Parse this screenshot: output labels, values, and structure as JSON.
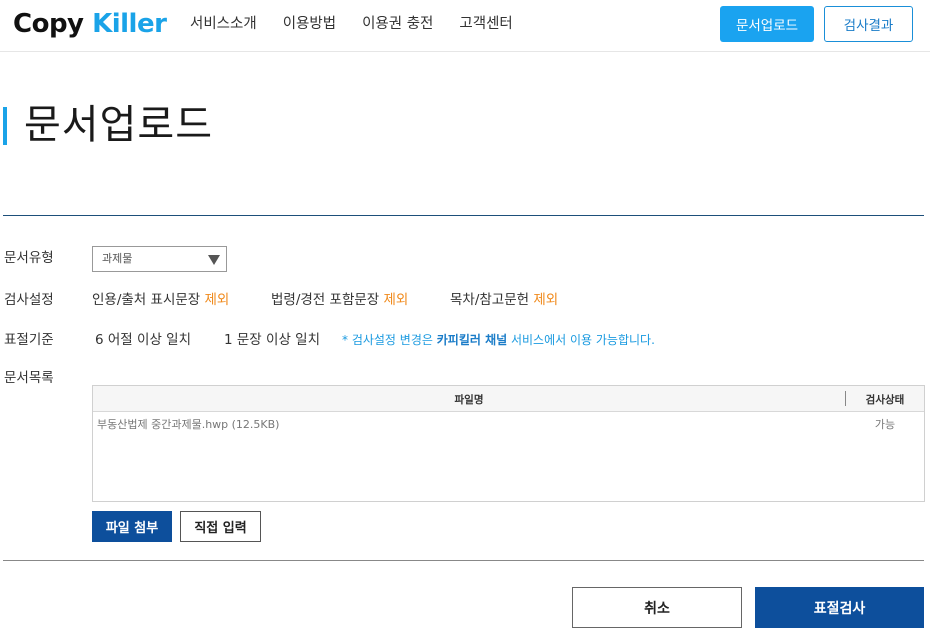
{
  "header": {
    "logo": {
      "part1": "Copy",
      "part2": "Killer"
    },
    "nav": [
      "서비스소개",
      "이용방법",
      "이용권 충전",
      "고객센터"
    ],
    "upload_button": "문서업로드",
    "result_button": "검사결과",
    "colors": {
      "accent": "#1aa3f0",
      "navy": "#0d4f9c",
      "orange": "#f08a1c"
    }
  },
  "page": {
    "title": "문서업로드"
  },
  "form": {
    "doc_type": {
      "label": "문서유형",
      "selected": "과제물"
    },
    "settings": {
      "label": "검사설정",
      "items": [
        {
          "name": "인용/출처 표시문장",
          "state": "제외"
        },
        {
          "name": "법령/경전 포함문장",
          "state": "제외"
        },
        {
          "name": "목차/참고문헌",
          "state": "제외"
        }
      ]
    },
    "criteria": {
      "label": "표절기준",
      "phrase_count": "6",
      "phrase_text": "어절 이상 일치",
      "sentence_count": "1",
      "sentence_text": "문장 이상 일치",
      "note_prefix": "* 검사설정 변경은 ",
      "note_bold": "카피킬러 채널",
      "note_suffix": " 서비스에서 이용 가능합니다."
    },
    "files": {
      "label": "문서목록",
      "columns": {
        "name": "파일명",
        "status": "검사상태"
      },
      "rows": [
        {
          "name": "부동산법제 중간과제물.hwp (12.5KB)",
          "status": "가능"
        }
      ],
      "attach_button": "파일 첨부",
      "direct_button": "직접 입력"
    }
  },
  "actions": {
    "cancel": "취소",
    "check": "표절검사"
  }
}
